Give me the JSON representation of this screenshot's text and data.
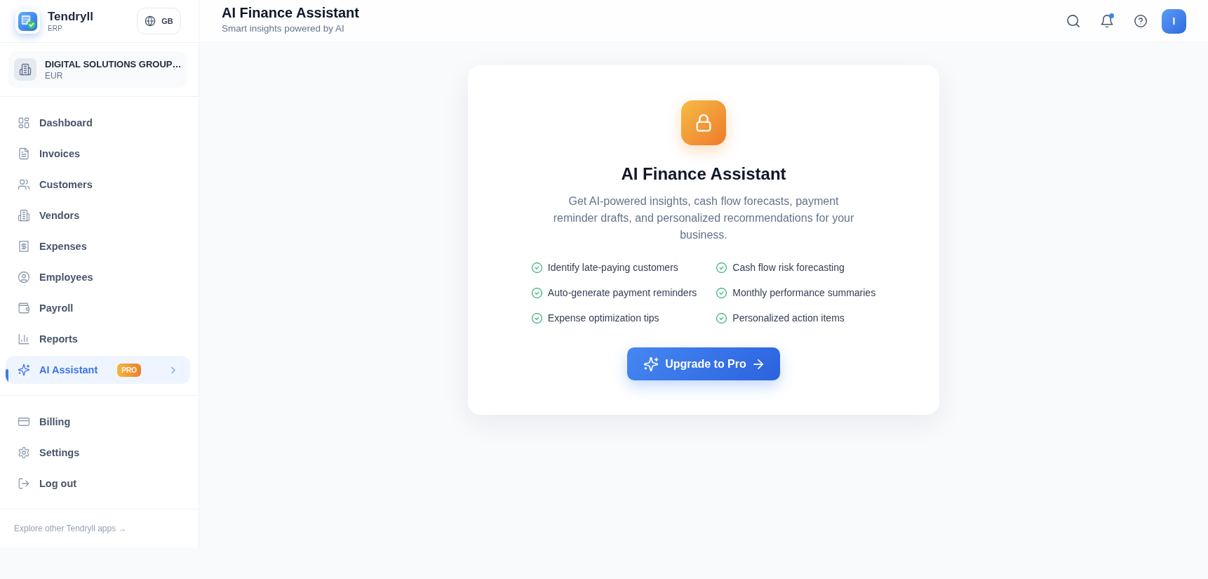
{
  "sidebar": {
    "brand": {
      "name": "Tendryll",
      "subtitle": "ERP"
    },
    "language_button": "GB",
    "company": {
      "name": "DIGITAL SOLUTIONS GROUP…",
      "currency": "EUR"
    },
    "nav_items": [
      {
        "label": "Dashboard",
        "selected": false
      },
      {
        "label": "Invoices",
        "selected": false
      },
      {
        "label": "Customers",
        "selected": false
      },
      {
        "label": "Vendors",
        "selected": false
      },
      {
        "label": "Expenses",
        "selected": false
      },
      {
        "label": "Employees",
        "selected": false
      },
      {
        "label": "Payroll",
        "selected": false
      },
      {
        "label": "Reports",
        "selected": false
      },
      {
        "label": "AI Assistant",
        "selected": true,
        "badge": "PRO"
      }
    ],
    "account_items": [
      {
        "label": "Billing",
        "selected": false
      },
      {
        "label": "Settings",
        "selected": false
      },
      {
        "label": "Log out",
        "selected": false
      }
    ],
    "footer_link": "Explore other Tendryll apps →"
  },
  "header": {
    "title": "AI Finance Assistant",
    "subtitle": "Smart insights powered by AI",
    "notifications_unread": true,
    "avatar_initial": "I"
  },
  "upgrade_card": {
    "title": "AI Finance Assistant",
    "description": "Get AI-powered insights, cash flow forecasts, payment reminder drafts, and personalized recommendations for your business.",
    "features": [
      "Identify late-paying customers",
      "Cash flow risk forecasting",
      "Auto-generate payment reminders",
      "Monthly performance summaries",
      "Expense optimization tips",
      "Personalized action items"
    ],
    "button": "Upgrade to Pro"
  }
}
